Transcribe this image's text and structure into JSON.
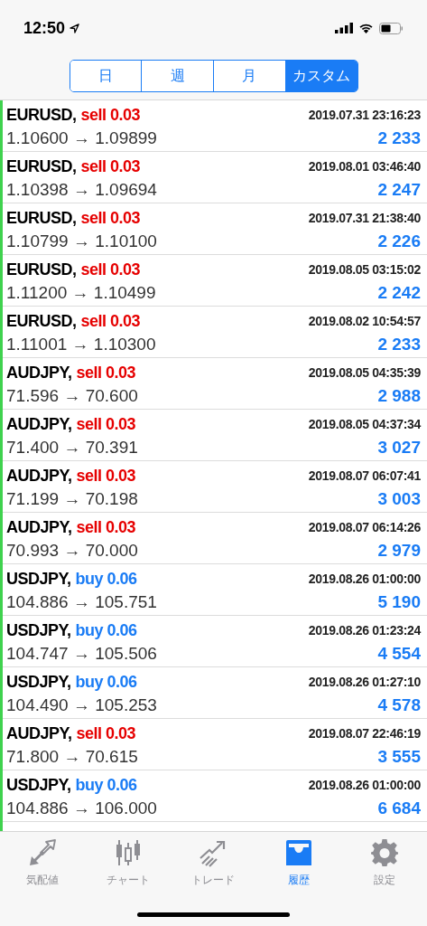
{
  "status_bar": {
    "time": "12:50"
  },
  "segments": [
    {
      "label": "日",
      "selected": false
    },
    {
      "label": "週",
      "selected": false
    },
    {
      "label": "月",
      "selected": false
    },
    {
      "label": "カスタム",
      "selected": true
    }
  ],
  "trades": [
    {
      "symbol": "EURUSD,",
      "kind": "sell",
      "order": "sell 0.03",
      "time": "2019.07.31 23:16:23",
      "prices": "1.10600 → 1.09899",
      "profit": "2 233"
    },
    {
      "symbol": "EURUSD,",
      "kind": "sell",
      "order": "sell 0.03",
      "time": "2019.08.01 03:46:40",
      "prices": "1.10398 → 1.09694",
      "profit": "2 247"
    },
    {
      "symbol": "EURUSD,",
      "kind": "sell",
      "order": "sell 0.03",
      "time": "2019.07.31 21:38:40",
      "prices": "1.10799 → 1.10100",
      "profit": "2 226"
    },
    {
      "symbol": "EURUSD,",
      "kind": "sell",
      "order": "sell 0.03",
      "time": "2019.08.05 03:15:02",
      "prices": "1.11200 → 1.10499",
      "profit": "2 242"
    },
    {
      "symbol": "EURUSD,",
      "kind": "sell",
      "order": "sell 0.03",
      "time": "2019.08.02 10:54:57",
      "prices": "1.11001 → 1.10300",
      "profit": "2 233"
    },
    {
      "symbol": "AUDJPY,",
      "kind": "sell",
      "order": "sell 0.03",
      "time": "2019.08.05 04:35:39",
      "prices": "71.596 → 70.600",
      "profit": "2 988"
    },
    {
      "symbol": "AUDJPY,",
      "kind": "sell",
      "order": "sell 0.03",
      "time": "2019.08.05 04:37:34",
      "prices": "71.400 → 70.391",
      "profit": "3 027"
    },
    {
      "symbol": "AUDJPY,",
      "kind": "sell",
      "order": "sell 0.03",
      "time": "2019.08.07 06:07:41",
      "prices": "71.199 → 70.198",
      "profit": "3 003"
    },
    {
      "symbol": "AUDJPY,",
      "kind": "sell",
      "order": "sell 0.03",
      "time": "2019.08.07 06:14:26",
      "prices": "70.993 → 70.000",
      "profit": "2 979"
    },
    {
      "symbol": "USDJPY,",
      "kind": "buy",
      "order": "buy 0.06",
      "time": "2019.08.26 01:00:00",
      "prices": "104.886 → 105.751",
      "profit": "5 190"
    },
    {
      "symbol": "USDJPY,",
      "kind": "buy",
      "order": "buy 0.06",
      "time": "2019.08.26 01:23:24",
      "prices": "104.747 → 105.506",
      "profit": "4 554"
    },
    {
      "symbol": "USDJPY,",
      "kind": "buy",
      "order": "buy 0.06",
      "time": "2019.08.26 01:27:10",
      "prices": "104.490 → 105.253",
      "profit": "4 578"
    },
    {
      "symbol": "AUDJPY,",
      "kind": "sell",
      "order": "sell 0.03",
      "time": "2019.08.07 22:46:19",
      "prices": "71.800 → 70.615",
      "profit": "3 555"
    },
    {
      "symbol": "USDJPY,",
      "kind": "buy",
      "order": "buy 0.06",
      "time": "2019.08.26 01:00:00",
      "prices": "104.886 → 106.000",
      "profit": "6 684"
    }
  ],
  "tab_bar": [
    {
      "label": "気配値",
      "selected": false
    },
    {
      "label": "チャート",
      "selected": false
    },
    {
      "label": "トレード",
      "selected": false
    },
    {
      "label": "履歴",
      "selected": true
    },
    {
      "label": "設定",
      "selected": false
    }
  ]
}
